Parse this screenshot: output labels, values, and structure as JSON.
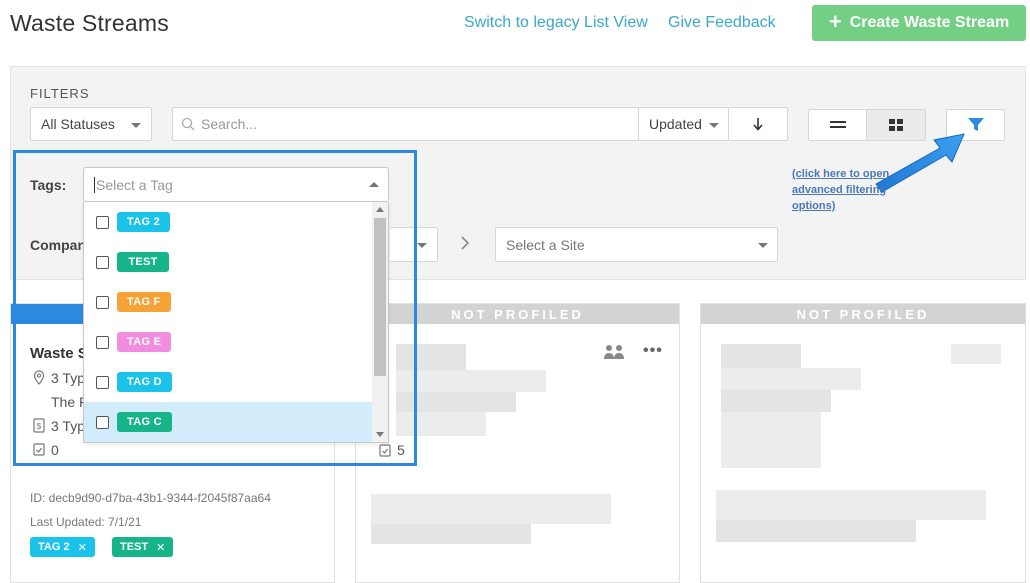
{
  "header": {
    "title": "Waste Streams",
    "legacy_link": "Switch to legacy List View",
    "feedback_link": "Give Feedback",
    "create_label": "Create Waste Stream"
  },
  "filters": {
    "label": "FILTERS",
    "status_value": "All Statuses",
    "search_placeholder": "Search...",
    "sort_value": "Updated",
    "tags_label": "Tags:",
    "tag_placeholder": "Select a Tag",
    "company_label": "Compan",
    "site_placeholder": "Select a Site",
    "hint": "(click here to open advanced filtering options)"
  },
  "tag_options": [
    {
      "label": "TAG 2",
      "color": "#1bc3ea"
    },
    {
      "label": "TEST",
      "color": "#17b48a"
    },
    {
      "label": "TAG F",
      "color": "#f5a236"
    },
    {
      "label": "TAG E",
      "color": "#f08de0"
    },
    {
      "label": "TAG D",
      "color": "#1bc3ea"
    },
    {
      "label": "TAG C",
      "color": "#17b48a"
    }
  ],
  "cards": [
    {
      "title": "Waste S",
      "line1": "3 Typ",
      "line2": "The F",
      "line3": "3 Typ",
      "count": "0",
      "id": "ID: decb9d90-d7ba-43b1-9344-f2045f87aa64",
      "updated": "Last Updated: 7/1/21",
      "tags": [
        {
          "label": "TAG 2",
          "color": "#1bc3ea"
        },
        {
          "label": "TEST",
          "color": "#17b48a"
        }
      ]
    },
    {
      "status": "NOT PROFILED",
      "count": "5"
    },
    {
      "status": "NOT PROFILED"
    }
  ]
}
